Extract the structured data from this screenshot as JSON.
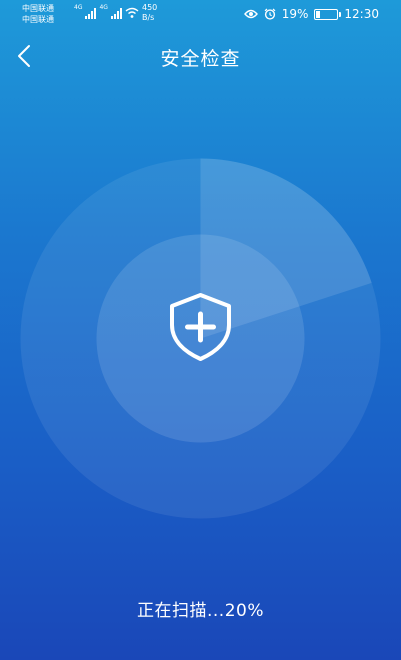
{
  "status_bar": {
    "carrier1": "中国联通",
    "carrier2": "中国联通",
    "net_tag1": "4G",
    "net_tag2": "4G",
    "speed_value": "450",
    "speed_unit": "B/s",
    "battery_percent": "19%",
    "time": "12:30"
  },
  "header": {
    "title": "安全检查"
  },
  "scan": {
    "status_label": "正在扫描...20%",
    "progress": 0.2
  },
  "icons": {
    "back": "chevron-left-icon",
    "shield": "shield-plus-icon"
  }
}
